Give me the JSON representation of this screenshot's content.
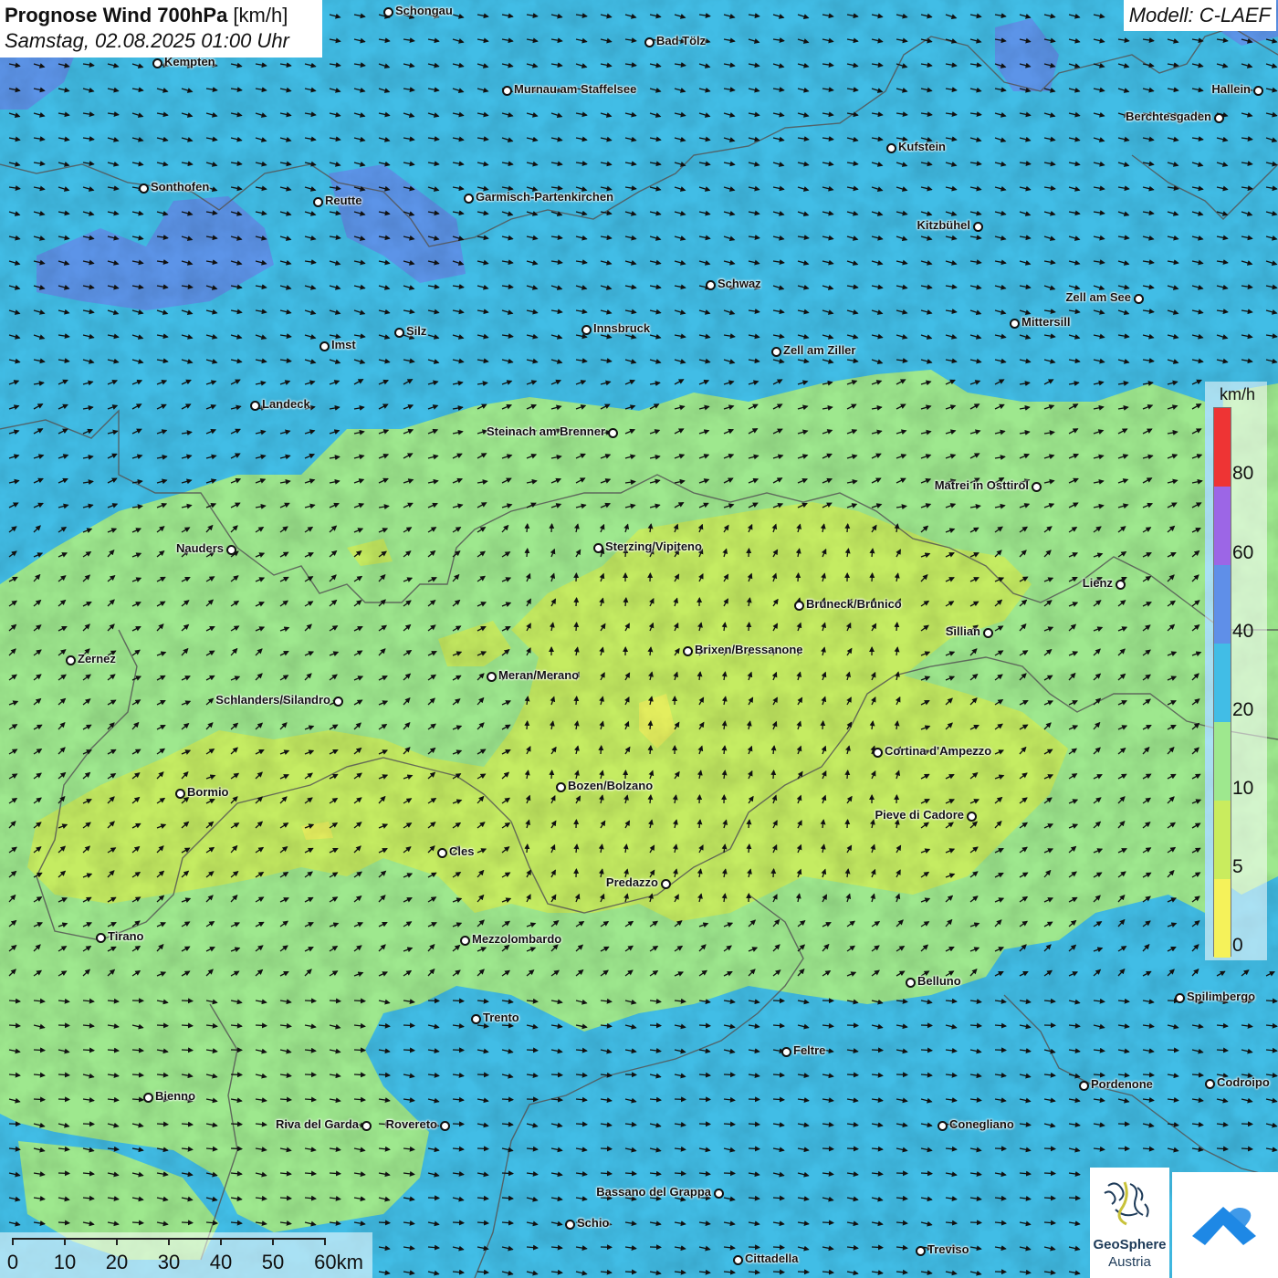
{
  "header": {
    "title_bold": "Prognose Wind 700hPa",
    "title_unit": " [km/h]",
    "datetime": "Samstag, 02.08.2025 01:00 Uhr",
    "model": "Modell: C-LAEF"
  },
  "colors": {
    "speed_0_5": "#f5f25a",
    "speed_5_10": "#c9ec5e",
    "speed_10_20": "#9ee88e",
    "speed_20_40": "#41bde6",
    "speed_40_60": "#5f8fe8",
    "speed_60_80": "#9c66e6",
    "speed_80_plus": "#ee3434",
    "border": "#555555",
    "arrow": "#111111"
  },
  "cities": [
    {
      "name": "Schongau",
      "side": "right",
      "icon": "city-dot-icon"
    },
    {
      "name": "Bad Tölz",
      "side": "right",
      "icon": "city-dot-icon"
    },
    {
      "name": "Kempten",
      "side": "right",
      "icon": "city-dot-icon"
    },
    {
      "name": "Murnau am Staffelsee",
      "side": "right",
      "icon": "city-dot-icon"
    },
    {
      "name": "Hallein",
      "side": "left",
      "icon": "city-dot-icon"
    },
    {
      "name": "Berchtesgaden",
      "side": "left",
      "icon": "city-dot-icon"
    },
    {
      "name": "Kufstein",
      "side": "right",
      "icon": "city-dot-icon"
    },
    {
      "name": "Sonthofen",
      "side": "right",
      "icon": "city-dot-icon"
    },
    {
      "name": "Reutte",
      "side": "right",
      "icon": "city-dot-icon"
    },
    {
      "name": "Garmisch-Partenkirchen",
      "side": "right",
      "icon": "city-dot-icon"
    },
    {
      "name": "Kitzbühel",
      "side": "left",
      "icon": "city-dot-icon"
    },
    {
      "name": "Schwaz",
      "side": "right",
      "icon": "city-dot-icon"
    },
    {
      "name": "Zell am See",
      "side": "left",
      "icon": "city-dot-icon"
    },
    {
      "name": "Mittersill",
      "side": "right",
      "icon": "city-dot-icon"
    },
    {
      "name": "Innsbruck",
      "side": "right",
      "icon": "city-dot-icon"
    },
    {
      "name": "Silz",
      "side": "right",
      "icon": "city-dot-icon"
    },
    {
      "name": "Imst",
      "side": "right",
      "icon": "city-dot-icon"
    },
    {
      "name": "Zell am Ziller",
      "side": "right",
      "icon": "city-dot-icon"
    },
    {
      "name": "Landeck",
      "side": "right",
      "icon": "city-dot-icon"
    },
    {
      "name": "Steinach am Brenner",
      "side": "left",
      "icon": "city-dot-icon"
    },
    {
      "name": "Matrei in Osttirol",
      "side": "left",
      "icon": "city-dot-icon"
    },
    {
      "name": "Nauders",
      "side": "left",
      "icon": "city-dot-icon"
    },
    {
      "name": "Sterzing/Vipiteno",
      "side": "right",
      "icon": "city-dot-icon"
    },
    {
      "name": "Lienz",
      "side": "left",
      "icon": "city-dot-icon"
    },
    {
      "name": "Bruneck/Brunico",
      "side": "right",
      "icon": "city-dot-icon"
    },
    {
      "name": "Sillian",
      "side": "left",
      "icon": "city-dot-icon"
    },
    {
      "name": "Brixen/Bressanone",
      "side": "right",
      "icon": "city-dot-icon"
    },
    {
      "name": "Zernez",
      "side": "right",
      "icon": "city-dot-icon"
    },
    {
      "name": "Meran/Merano",
      "side": "right",
      "icon": "city-dot-icon"
    },
    {
      "name": "Schlanders/Silandro",
      "side": "left",
      "icon": "city-dot-icon"
    },
    {
      "name": "Cortina d'Ampezzo",
      "side": "right",
      "icon": "city-dot-icon"
    },
    {
      "name": "Bozen/Bolzano",
      "side": "right",
      "icon": "city-dot-icon"
    },
    {
      "name": "Bormio",
      "side": "right",
      "icon": "city-dot-icon"
    },
    {
      "name": "Pieve di Cadore",
      "side": "left",
      "icon": "city-dot-icon"
    },
    {
      "name": "Cles",
      "side": "right",
      "icon": "city-dot-icon"
    },
    {
      "name": "Predazzo",
      "side": "left",
      "icon": "city-dot-icon"
    },
    {
      "name": "Tirano",
      "side": "right",
      "icon": "city-dot-icon"
    },
    {
      "name": "Mezzolombardo",
      "side": "right",
      "icon": "city-dot-icon"
    },
    {
      "name": "Belluno",
      "side": "right",
      "icon": "city-dot-icon"
    },
    {
      "name": "Spilimbergo",
      "side": "right",
      "icon": "city-dot-icon"
    },
    {
      "name": "Trento",
      "side": "right",
      "icon": "city-dot-icon"
    },
    {
      "name": "Feltre",
      "side": "right",
      "icon": "city-dot-icon"
    },
    {
      "name": "Bienno",
      "side": "right",
      "icon": "city-dot-icon"
    },
    {
      "name": "Pordenone",
      "side": "right",
      "icon": "city-dot-icon"
    },
    {
      "name": "Codroipo",
      "side": "right",
      "icon": "city-dot-icon"
    },
    {
      "name": "Riva del Garda",
      "side": "left",
      "icon": "city-dot-icon"
    },
    {
      "name": "Rovereto",
      "side": "left",
      "icon": "city-dot-icon"
    },
    {
      "name": "Conegliano",
      "side": "right",
      "icon": "city-dot-icon"
    },
    {
      "name": "Bassano del Grappa",
      "side": "left",
      "icon": "city-dot-icon"
    },
    {
      "name": "Schio",
      "side": "right",
      "icon": "city-dot-icon"
    },
    {
      "name": "Treviso",
      "side": "right",
      "icon": "city-dot-icon"
    },
    {
      "name": "Cittadella",
      "side": "right",
      "icon": "city-dot-icon"
    }
  ],
  "legend": {
    "unit": "km/h",
    "labels": [
      "80",
      "60",
      "40",
      "20",
      "10",
      "5",
      "0"
    ]
  },
  "scale_bar": {
    "labels": [
      "0",
      "10",
      "20",
      "30",
      "40",
      "50",
      "60km"
    ]
  },
  "logos": {
    "geosphere_line1": "GeoSphere",
    "geosphere_line2": "Austria",
    "geosphere_icon": "geosphere-swirl-icon",
    "app_icon": "wind-app-icon"
  }
}
